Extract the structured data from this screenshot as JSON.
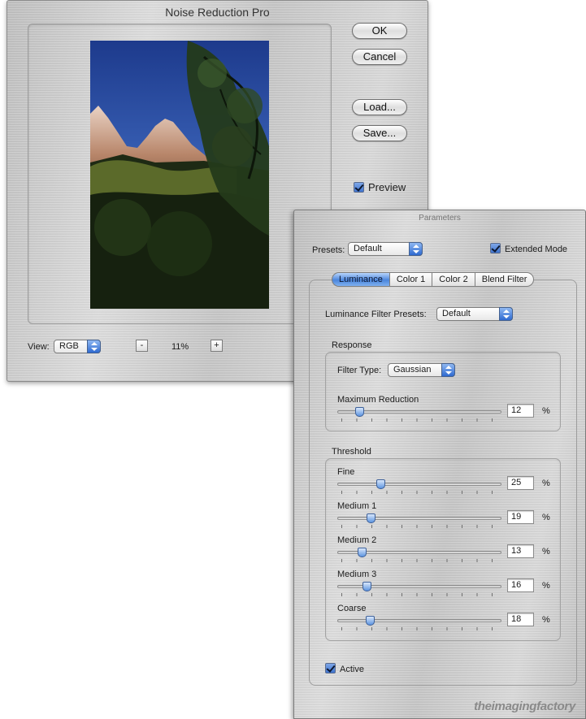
{
  "main_window": {
    "title": "Noise Reduction Pro",
    "buttons": {
      "ok": "OK",
      "cancel": "Cancel",
      "load": "Load...",
      "save": "Save..."
    },
    "preview_label": "Preview",
    "preview_checked": true,
    "view_label": "View:",
    "view_value": "RGB",
    "zoom_minus": "-",
    "zoom_plus": "+",
    "zoom_value": "11%"
  },
  "params_window": {
    "title": "Parameters",
    "presets_label": "Presets:",
    "presets_value": "Default",
    "extended_mode_label": "Extended Mode",
    "extended_mode_checked": true,
    "tabs": [
      {
        "label": "Luminance",
        "active": true
      },
      {
        "label": "Color 1",
        "active": false
      },
      {
        "label": "Color 2",
        "active": false
      },
      {
        "label": "Blend Filter",
        "active": false
      }
    ],
    "lum_presets_label": "Luminance Filter Presets:",
    "lum_presets_value": "Default",
    "response": {
      "title": "Response",
      "filter_type_label": "Filter Type:",
      "filter_type_value": "Gaussian",
      "max_reduction": {
        "label": "Maximum Reduction",
        "value": "12",
        "unit": "%"
      }
    },
    "threshold": {
      "title": "Threshold",
      "sliders": [
        {
          "label": "Fine",
          "value": "25",
          "unit": "%"
        },
        {
          "label": "Medium 1",
          "value": "19",
          "unit": "%"
        },
        {
          "label": "Medium 2",
          "value": "13",
          "unit": "%"
        },
        {
          "label": "Medium 3",
          "value": "16",
          "unit": "%"
        },
        {
          "label": "Coarse",
          "value": "18",
          "unit": "%"
        }
      ]
    },
    "active_label": "Active",
    "active_checked": true,
    "brand": "theimagingfactory"
  },
  "colors": {
    "accent": "#4b86dc",
    "metal": "#c9c9c9"
  }
}
